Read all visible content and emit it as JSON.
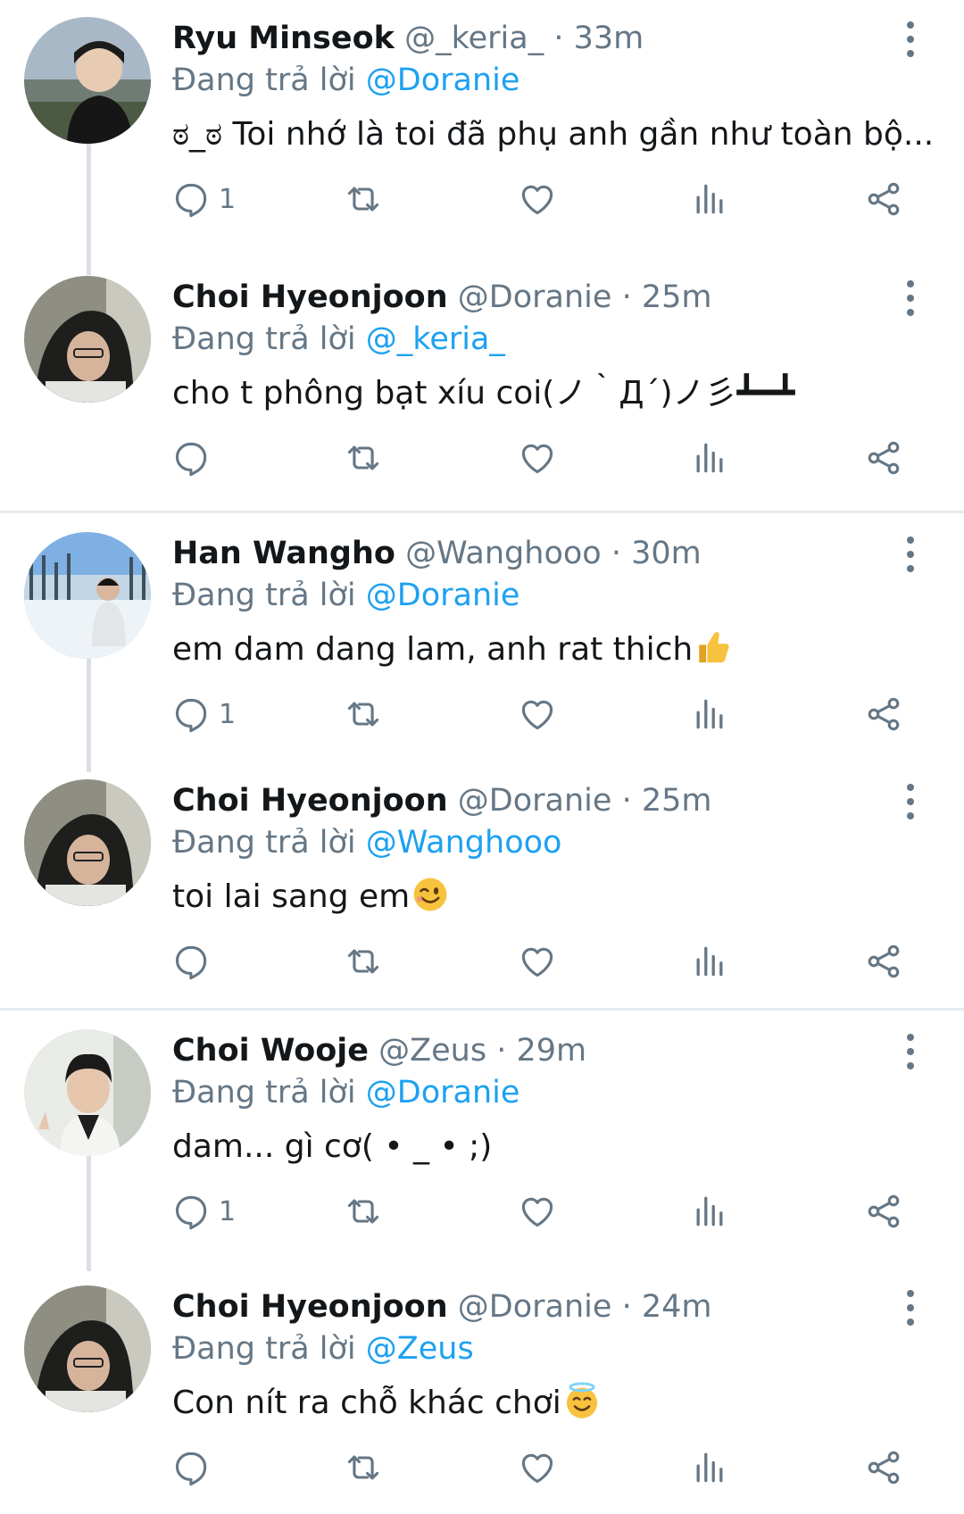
{
  "colors": {
    "accent": "#1da1f2",
    "muted": "#657786",
    "text": "#14171a",
    "divider": "#e6ecf0"
  },
  "reply_prefix": "Đang trả lời",
  "tweets": [
    {
      "name": "Ryu Minseok",
      "handle": "@_keria_",
      "time": "33m",
      "reply_to": "@Doranie",
      "text": "ಠ_ಠ Toi nhớ là toi đã phụ anh gần như toàn bộ...",
      "reply_count": "1",
      "emoji": ""
    },
    {
      "name": "Choi Hyeonjoon",
      "handle": "@Doranie",
      "time": "25m",
      "reply_to": "@_keria_",
      "text": "cho t phông bạt xíu coi(ノ｀Д´)ノ彡┻━┻",
      "reply_count": "",
      "emoji": ""
    },
    {
      "name": "Han Wangho",
      "handle": "@Wanghooo",
      "time": "30m",
      "reply_to": "@Doranie",
      "text": "em dam dang lam, anh rat thich",
      "reply_count": "1",
      "emoji": "thumbs-up"
    },
    {
      "name": "Choi Hyeonjoon",
      "handle": "@Doranie",
      "time": "25m",
      "reply_to": "@Wanghooo",
      "text": "toi lai sang em",
      "reply_count": "",
      "emoji": "winking-face"
    },
    {
      "name": "Choi Wooje",
      "handle": "@Zeus",
      "time": "29m",
      "reply_to": "@Doranie",
      "text": "dam... gì cơ( • _ • ;)",
      "reply_count": "1",
      "emoji": ""
    },
    {
      "name": "Choi Hyeonjoon",
      "handle": "@Doranie",
      "time": "24m",
      "reply_to": "@Zeus",
      "text": "Con nít ra chỗ khác chơi",
      "reply_count": "",
      "emoji": "smiling-face-with-halo"
    }
  ]
}
